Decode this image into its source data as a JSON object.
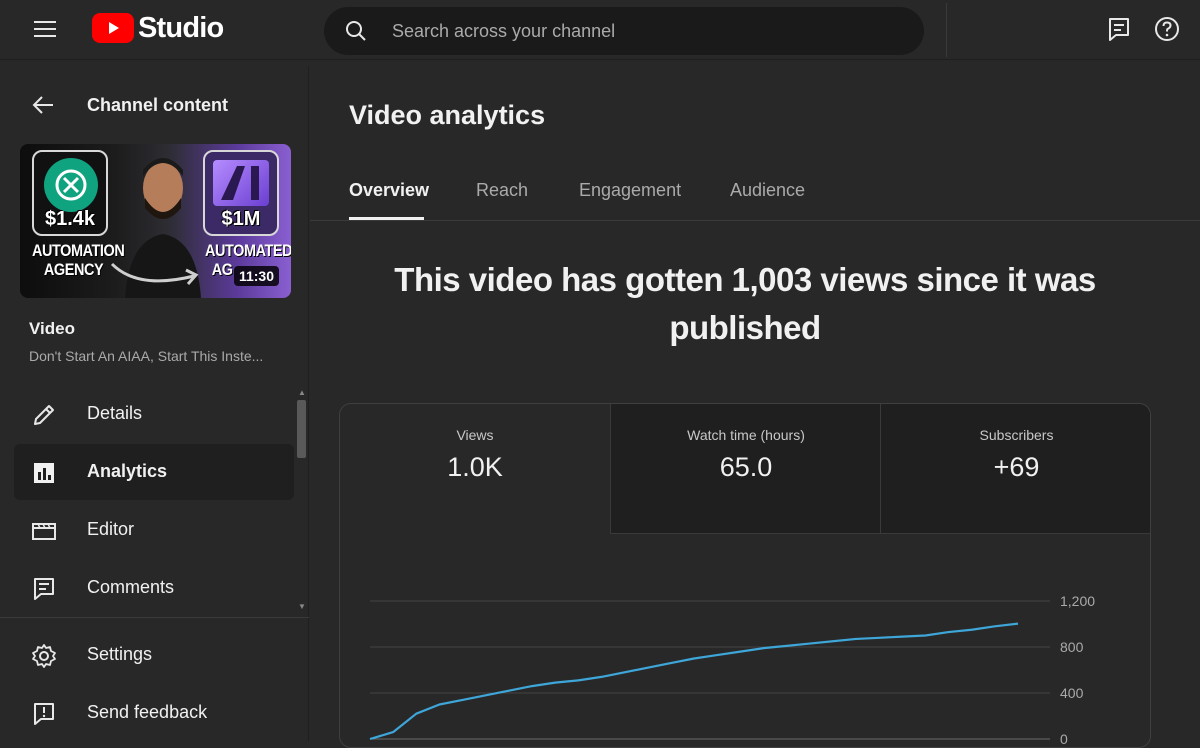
{
  "header": {
    "brand": "Studio",
    "search_placeholder": "Search across your channel"
  },
  "sidebar": {
    "back_label": "Channel content",
    "thumbnail": {
      "left_badge": "$1.4k",
      "right_badge": "$1M",
      "left_caption_1": "AUTOMATION",
      "left_caption_2": "AGENCY",
      "right_caption_1": "AUTOMATED",
      "right_caption_2": "AG",
      "duration": "11:30"
    },
    "video_label": "Video",
    "video_title": "Don't Start An AIAA, Start This Inste...",
    "items": [
      {
        "label": "Details"
      },
      {
        "label": "Analytics"
      },
      {
        "label": "Editor"
      },
      {
        "label": "Comments"
      }
    ],
    "footer_items": [
      {
        "label": "Settings"
      },
      {
        "label": "Send feedback"
      }
    ]
  },
  "main": {
    "title": "Video analytics",
    "tabs": [
      {
        "label": "Overview"
      },
      {
        "label": "Reach"
      },
      {
        "label": "Engagement"
      },
      {
        "label": "Audience"
      }
    ],
    "active_tab": "Overview",
    "headline": "This video has gotten 1,003 views since it was published",
    "metrics": [
      {
        "label": "Views",
        "value": "1.0K"
      },
      {
        "label": "Watch time (hours)",
        "value": "65.0"
      },
      {
        "label": "Subscribers",
        "value": "+69"
      }
    ]
  },
  "colors": {
    "background": "#282828",
    "brand_red": "#ff0000",
    "line": "#3ea6d8"
  },
  "chart_data": {
    "type": "line",
    "ylim": [
      0,
      1200
    ],
    "y_ticks": [
      "1,200",
      "800",
      "400",
      "0"
    ],
    "y_tick_values": [
      1200,
      800,
      400,
      0
    ],
    "series": [
      {
        "x": [
          0,
          1,
          2,
          3,
          4,
          5,
          6,
          7,
          8,
          9,
          10,
          11,
          12,
          13,
          14,
          15,
          16,
          17,
          18,
          19,
          20,
          21,
          22,
          23,
          24,
          25,
          26,
          27,
          28
        ],
        "values": [
          0,
          60,
          220,
          300,
          340,
          380,
          420,
          460,
          490,
          510,
          540,
          580,
          620,
          660,
          700,
          730,
          760,
          790,
          810,
          830,
          850,
          870,
          880,
          890,
          900,
          930,
          950,
          980,
          1003
        ]
      }
    ]
  }
}
